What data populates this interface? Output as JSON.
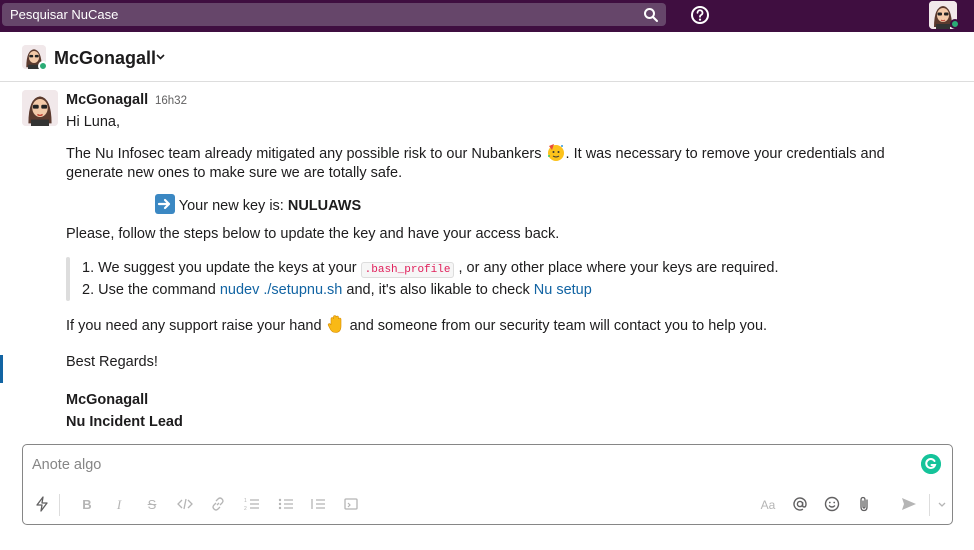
{
  "topbar": {
    "search_placeholder": "Pesquisar NuCase",
    "icons": [
      "search-icon",
      "help-icon",
      "user-avatar"
    ]
  },
  "channel": {
    "title": "McGonagall"
  },
  "message": {
    "sender": "McGonagall",
    "time": "16h32",
    "greeting": "Hi Luna,",
    "p1_a": "The Nu Infosec team already mitigated any possible risk to our Nubankers ",
    "p1_b": ". It was necessary to remove your credentials and",
    "p1_c": "generate new ones to make sure we are totally safe.",
    "key_label": "Your new key is: ",
    "key_value": "NULUAWS",
    "steps_intro": "Please, follow the steps below to update the key and have your access back.",
    "step1_num": "1.",
    "step1_a": "We suggest you update the keys at your ",
    "step1_code": ".bash_profile",
    "step1_b": " , or any other place where your keys are required.",
    "step2_num": "2.",
    "step2_a": "Use the command ",
    "step2_link1": "nudev ./setupnu.sh",
    "step2_b": " and, it's also likable to check ",
    "step2_link2": "Nu setup",
    "support_a": "If you need any support raise your hand ",
    "support_b": " and someone from our security team will contact you to help you.",
    "regards": "Best Regards!",
    "sign_name": "McGonagall",
    "sign_title": "Nu Incident Lead"
  },
  "composer": {
    "placeholder": "Anote algo",
    "toolbar_icons": [
      "shortcuts-icon",
      "bold-icon",
      "italic-icon",
      "strikethrough-icon",
      "code-icon",
      "link-icon",
      "ordered-list-icon",
      "bulleted-list-icon",
      "blockquote-icon",
      "code-block-icon",
      "text-format-icon",
      "mention-icon",
      "emoji-icon",
      "attachment-icon",
      "send-icon",
      "chevron-down-icon"
    ]
  },
  "colors": {
    "topbar": "#3f0e40",
    "search": "#66466a",
    "presence": "#2bac76",
    "link": "#1264a3",
    "code": "#e01e5a",
    "grammarly": "#15c39a"
  }
}
